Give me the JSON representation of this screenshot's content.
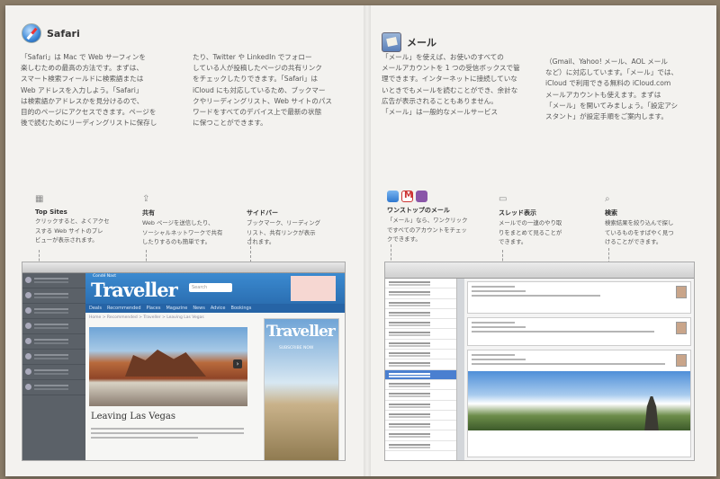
{
  "safari": {
    "title": "Safari",
    "icon": "safari-compass-icon",
    "col1": [
      "「Safari」は Mac で Web サーフィンを",
      "楽しむための最高の方法です。まずは、",
      "スマート検索フィールドに検索語または",
      "Web アドレスを入力しよう。「Safari」",
      "は検索語かアドレスかを見分けるので、",
      "目的のページにアクセスできます。ページを",
      "後で読むためにリーディングリストに保存し"
    ],
    "col2": [
      "たり、Twitter や LinkedIn でフォロー",
      "している人が投稿したページの共有リンク",
      "をチェックしたりできます。「Safari」は",
      "iCloud にも対応しているため、ブックマー",
      "クやリーディングリスト、Web サイトのパス",
      "ワードをすべてのデバイス上で最新の状態",
      "に保つことができます。"
    ],
    "features": [
      {
        "icon": "grid-icon",
        "glyph": "▦",
        "name": "Top Sites",
        "desc": [
          "クリックすると、よくアクセ",
          "スする Web サイトのプレ",
          "ビューが表示されます。"
        ]
      },
      {
        "icon": "share-icon",
        "glyph": "⇪",
        "name": "共有",
        "desc": [
          "Web ページを送信したり、",
          "ソーシャルネットワークで共有",
          "したりするのも簡単です。"
        ]
      },
      {
        "icon": "sidebar-icon",
        "glyph": "",
        "name": "サイドバー",
        "desc": [
          "ブックマーク、リーディング",
          "リスト、共有リンクが表示",
          "されます。"
        ]
      }
    ],
    "browser": {
      "logo": "Traveller",
      "logo_small": "Condé Nast",
      "search_placeholder": "Search",
      "nav": [
        "Deals",
        "Recommended",
        "Places",
        "Magazine",
        "News",
        "Advice",
        "Bookings"
      ],
      "crumb": "Home > Recommended > Traveller > Leaving Las Vegas",
      "headline": "Leaving Las Vegas",
      "mag_title": "Traveller",
      "mag_sub": "SUBSCRIBE NOW"
    }
  },
  "mail": {
    "title": "メール",
    "icon": "mail-stamp-icon",
    "col1": [
      "「メール」を使えば、お使いのすべての",
      "メールアカウントを 1 つの受信ボックスで管",
      "理できます。インターネットに接続していな",
      "いときでもメールを読むことができ、余計な",
      "広告が表示されることもありません。",
      "「メール」は一般的なメールサービス"
    ],
    "col2": [
      "（Gmail、Yahoo! メール、AOL メール",
      "など）に対応しています。「メール」では、",
      "iCloud で利用できる無料の iCloud.com",
      "メールアカウントも使えます。まずは",
      "「メール」を開いてみましょう。「設定アシ",
      "スタント」が設定手順をご案内します。"
    ],
    "features": [
      {
        "icon": "account-logos-icon",
        "name": "ワンストップのメール",
        "desc": [
          "「メール」なら、ワンクリック",
          "ですべてのアカウントをチェッ",
          "クできます。"
        ]
      },
      {
        "icon": "conversation-icon",
        "glyph": "▭",
        "name": "スレッド表示",
        "desc": [
          "メールでの一連のやり取",
          "りをまとめて見ることが",
          "できます。"
        ]
      },
      {
        "icon": "search-icon",
        "glyph": "⌕",
        "name": "検索",
        "desc": [
          "検索結果を絞り込んで探し",
          "ているものをすばやく見つ",
          "けることができます。"
        ]
      }
    ]
  }
}
